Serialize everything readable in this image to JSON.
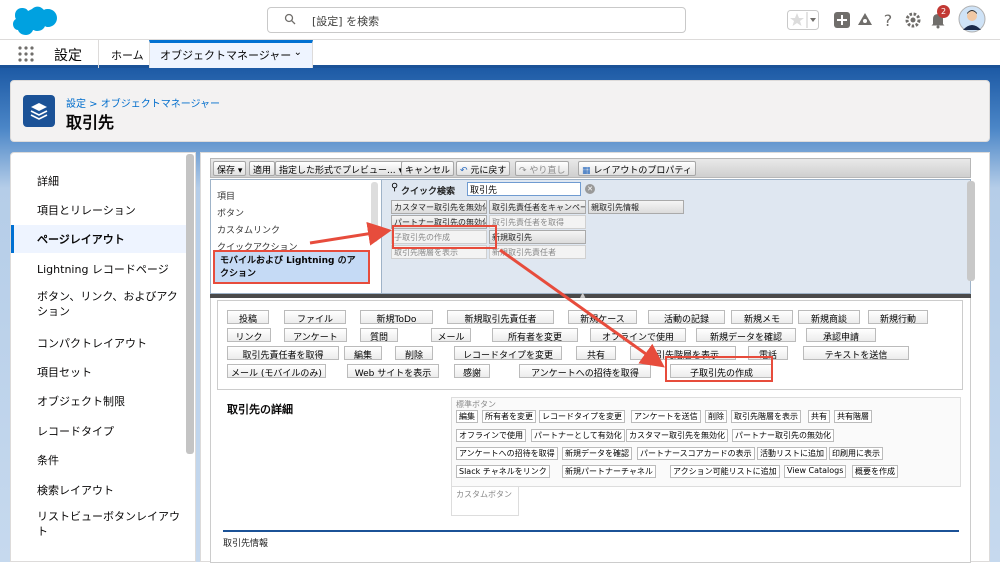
{
  "topbar": {
    "search_placeholder": "[設定] を検索",
    "notification_count": "2",
    "colors": {
      "brand": "#00a1e0",
      "accent": "#0070d2",
      "badge": "#c23934"
    }
  },
  "nav": {
    "app_name": "設定",
    "home": "ホーム",
    "tab": "オブジェクトマネージャー"
  },
  "header": {
    "breadcrumb": "設定 > オブジェクトマネージャー",
    "title": "取引先"
  },
  "sidebar": {
    "items": [
      {
        "label": "詳細"
      },
      {
        "label": "項目とリレーション"
      },
      {
        "label": "ページレイアウト",
        "active": true
      },
      {
        "label": "Lightning レコードページ"
      },
      {
        "label": "ボタン、リンク、およびアクション"
      },
      {
        "label": "コンパクトレイアウト"
      },
      {
        "label": "項目セット"
      },
      {
        "label": "オブジェクト制限"
      },
      {
        "label": "レコードタイプ"
      },
      {
        "label": "条件"
      },
      {
        "label": "検索レイアウト"
      },
      {
        "label": "リストビューボタンレイアウト"
      }
    ]
  },
  "toolbar": {
    "save": "保存",
    "apply": "適用",
    "preview": "指定した形式でプレビュー...",
    "cancel": "キャンセル",
    "undo": "元に戻す",
    "redo": "やり直し",
    "props": "レイアウトのプロパティ"
  },
  "palette": {
    "categories": [
      "項目",
      "ボタン",
      "カスタムリンク",
      "クイックアクション"
    ],
    "selected_category": "モバイルおよび Lightning のアクション",
    "quick_find_label": "クイック検索",
    "quick_find_value": "取引先",
    "items": [
      {
        "label": "カスタマー取引先を無効化",
        "used": false
      },
      {
        "label": "取引先責任者をキャンペーン",
        "used": false
      },
      {
        "label": "親取引先情報",
        "used": false
      },
      {
        "label": "パートナー取引先の無効化",
        "used": false
      },
      {
        "label": "取引先責任者を取得",
        "used": true
      },
      {
        "label": "子取引先の作成",
        "used": true
      },
      {
        "label": "新規取引先",
        "used": false
      },
      {
        "label": "取引先階層を表示",
        "used": true
      },
      {
        "label": "新規取引先責任者",
        "used": true
      }
    ]
  },
  "actions": {
    "rows": [
      [
        "投稿",
        "ファイル",
        "新規ToDo",
        "新規取引先責任者",
        "新規ケース",
        "活動の記録",
        "新規メモ",
        "新規商談",
        "新規行動"
      ],
      [
        "リンク",
        "アンケート",
        "質問",
        "メール",
        "所有者を変更",
        "オフラインで使用",
        "新規データを確認",
        "承認申請"
      ],
      [
        "取引先責任者を取得",
        "編集",
        "削除",
        "レコードタイプを変更",
        "共有",
        "取引先階層を表示",
        "電話",
        "テキストを送信"
      ],
      [
        "メール (モバイルのみ)",
        "Web サイトを表示",
        "感謝",
        "アンケートへの招待を取得",
        "子取引先の作成"
      ]
    ]
  },
  "detail": {
    "title": "取引先の詳細",
    "std_label": "標準ボタン",
    "std_buttons": [
      [
        "編集",
        "所有者を変更",
        "レコードタイプを変更",
        "アンケートを送信",
        "削除",
        "取引先階層を表示",
        "共有",
        "共有階層"
      ],
      [
        "オフラインで使用",
        "パートナーとして有効化",
        "カスタマー取引先を無効化",
        "パートナー取引先の無効化"
      ],
      [
        "アンケートへの招待を取得",
        "新規データを確認",
        "パートナースコアカードの表示",
        "活動リストに追加",
        "印刷用に表示"
      ],
      [
        "Slack チャネルをリンク",
        "新規パートナーチャネル",
        "アクション可能リストに追加",
        "View Catalogs",
        "概要を作成"
      ]
    ],
    "custom_label": "カスタムボタン",
    "section_label": "取引先情報"
  }
}
